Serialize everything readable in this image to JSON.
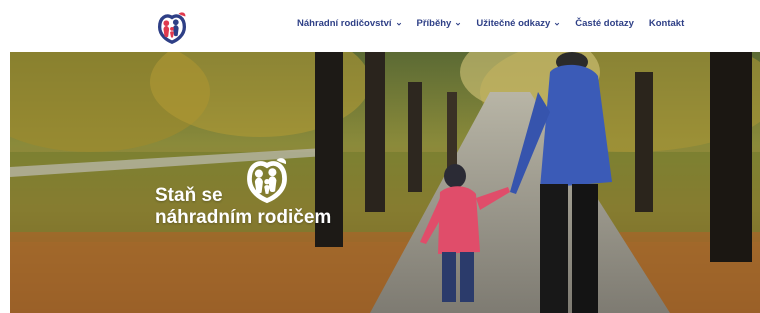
{
  "nav": {
    "items": [
      {
        "label": "Náhradní rodičovství",
        "has_dropdown": true,
        "icon": "chevron-down-icon"
      },
      {
        "label": "Příběhy",
        "has_dropdown": true,
        "icon": "chevron-down-icon"
      },
      {
        "label": "Užitečné odkazy",
        "has_dropdown": true,
        "icon": "chevron-down-icon"
      },
      {
        "label": "Časté dotazy",
        "has_dropdown": false
      },
      {
        "label": "Kontakt",
        "has_dropdown": false
      }
    ]
  },
  "hero": {
    "title_line1": "Staň se",
    "title_line2": "náhradním rodičem"
  },
  "colors": {
    "nav_text": "#2e3f86",
    "logo_blue": "#2e3f86",
    "logo_red": "#e03a4e",
    "hero_text": "#ffffff"
  },
  "icons": {
    "logo": "family-heart-logo",
    "hero_logo": "family-heart-logo-white"
  }
}
